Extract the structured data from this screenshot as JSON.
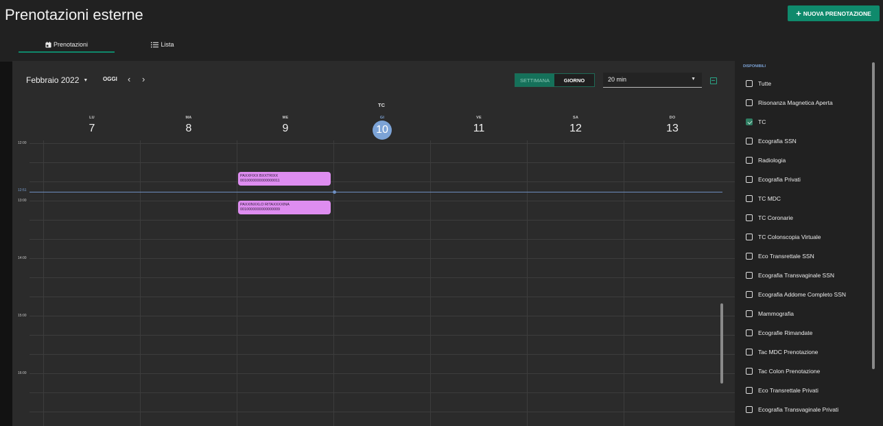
{
  "header": {
    "title": "Prenotazioni esterne",
    "new_button": "NUOVA PRENOTAZIONE",
    "tabs": [
      {
        "label": "Prenotazioni",
        "icon": "calendar-icon",
        "active": true
      },
      {
        "label": "Lista",
        "icon": "list-icon",
        "active": false
      }
    ]
  },
  "toolbar": {
    "month": "Febbraio 2022",
    "today": "OGGI",
    "prev": "‹",
    "next": "›",
    "view_week": "SETTIMANA",
    "view_day": "GIORNO",
    "interval": "20 min"
  },
  "calendar": {
    "resource": "TC",
    "days": [
      {
        "dow": "LU",
        "date": "7"
      },
      {
        "dow": "MA",
        "date": "8"
      },
      {
        "dow": "ME",
        "date": "9"
      },
      {
        "dow": "GI",
        "date": "10",
        "today": true
      },
      {
        "dow": "VE",
        "date": "11"
      },
      {
        "dow": "SA",
        "date": "12"
      },
      {
        "dow": "DO",
        "date": "13"
      }
    ],
    "times": [
      "12:00",
      "13:00",
      "14:00",
      "15:00",
      "16:00"
    ],
    "now": "12:51",
    "events": [
      {
        "name": "PAXXFIXX BXXTRIXX",
        "code": "0010000000000000011"
      },
      {
        "name": "PAXXINXXLO RITAXXXXINA",
        "code": "0010000000000000009"
      }
    ]
  },
  "sidebar": {
    "heading": "DISPONIBILI",
    "items": [
      {
        "label": "Tutte",
        "checked": false
      },
      {
        "label": "Risonanza Magnetica Aperta",
        "checked": false
      },
      {
        "label": "TC",
        "checked": true
      },
      {
        "label": "Ecografia SSN",
        "checked": false
      },
      {
        "label": "Radiologia",
        "checked": false
      },
      {
        "label": "Ecografia Privati",
        "checked": false
      },
      {
        "label": "TC MDC",
        "checked": false
      },
      {
        "label": "TC Coronarie",
        "checked": false
      },
      {
        "label": "TC Colonscopia Virtuale",
        "checked": false
      },
      {
        "label": "Eco Transrettale SSN",
        "checked": false
      },
      {
        "label": "Ecografia Transvaginale SSN",
        "checked": false
      },
      {
        "label": "Ecografia Addome Completo SSN",
        "checked": false
      },
      {
        "label": "Mammografia",
        "checked": false
      },
      {
        "label": "Ecografie Rimandate",
        "checked": false
      },
      {
        "label": "Tac MDC Prenotazione",
        "checked": false
      },
      {
        "label": "Tac Colon Prenotazione",
        "checked": false
      },
      {
        "label": "Eco Transrettale Privati",
        "checked": false
      },
      {
        "label": "Ecografia Transvaginale Privati",
        "checked": false
      }
    ]
  },
  "colors": {
    "accent": "#0f8a6c",
    "today": "#7ca3d6",
    "event": "#de8df0",
    "now_line": "#6e8fc2"
  }
}
